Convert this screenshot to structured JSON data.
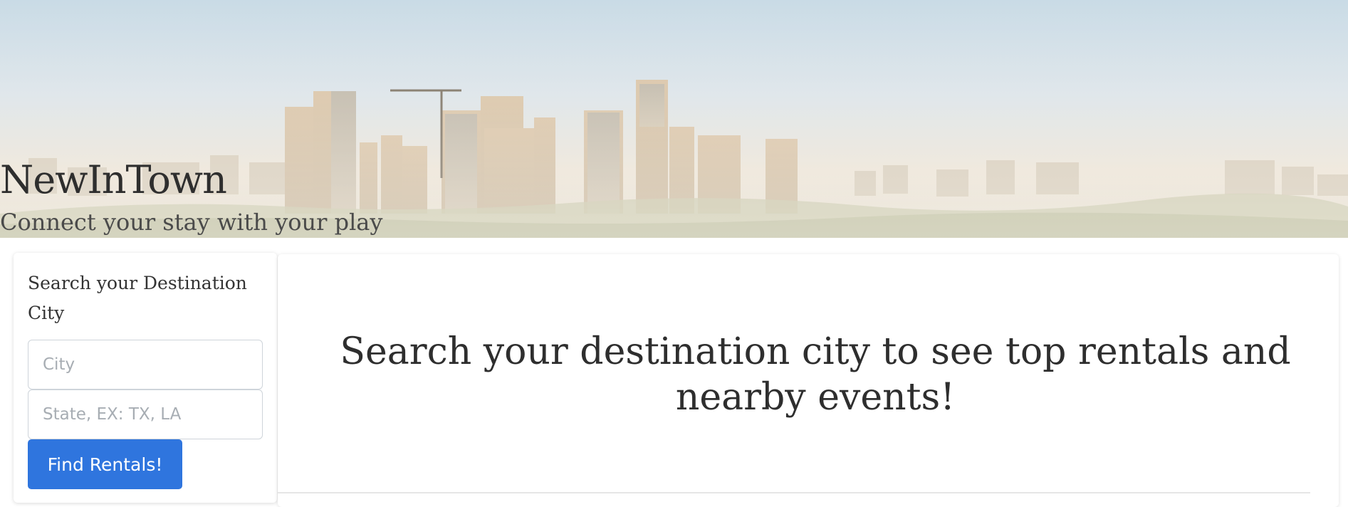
{
  "hero": {
    "title": "NewInTown",
    "subtitle": "Connect your stay with your play"
  },
  "search": {
    "heading": "Search your Destination City",
    "city_placeholder": "City",
    "state_placeholder": "State, EX: TX, LA",
    "button_label": "Find Rentals!"
  },
  "main": {
    "heading": "Search your destination city to see top rentals and nearby events!"
  },
  "colors": {
    "accent": "#2f75de",
    "text": "#333333"
  }
}
